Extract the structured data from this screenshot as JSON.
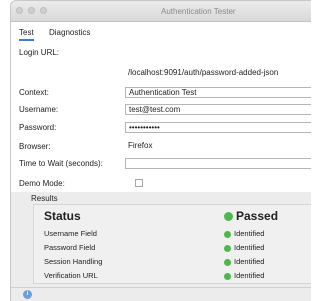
{
  "window": {
    "title": "Authentication Tester"
  },
  "tabs": [
    {
      "label": "Test"
    },
    {
      "label": "Diagnostics"
    }
  ],
  "form": {
    "login_url": {
      "label": "Login URL:",
      "value": "/localhost:9091/auth/password-added-json"
    },
    "context": {
      "label": "Context:",
      "value": "Authentication Test"
    },
    "username": {
      "label": "Username:",
      "value": "test@test.com"
    },
    "password": {
      "label": "Password:",
      "value": "•••••••••••"
    },
    "browser": {
      "label": "Browser:",
      "value": "Firefox"
    },
    "time_to_wait": {
      "label": "Time to Wait (seconds):",
      "value": ""
    },
    "demo_mode": {
      "label": "Demo Mode:",
      "checked": false
    }
  },
  "results": {
    "section_label": "Results",
    "status_header": "Status",
    "overall_status": "Passed",
    "status_color": "#4cb84c",
    "rows": [
      {
        "label": "Username Field",
        "value": "Identified"
      },
      {
        "label": "Password Field",
        "value": "Identified"
      },
      {
        "label": "Session Handling",
        "value": "Identified"
      },
      {
        "label": "Verification URL",
        "value": "Identified"
      }
    ]
  },
  "statusbar": {
    "icon": "info-icon"
  }
}
